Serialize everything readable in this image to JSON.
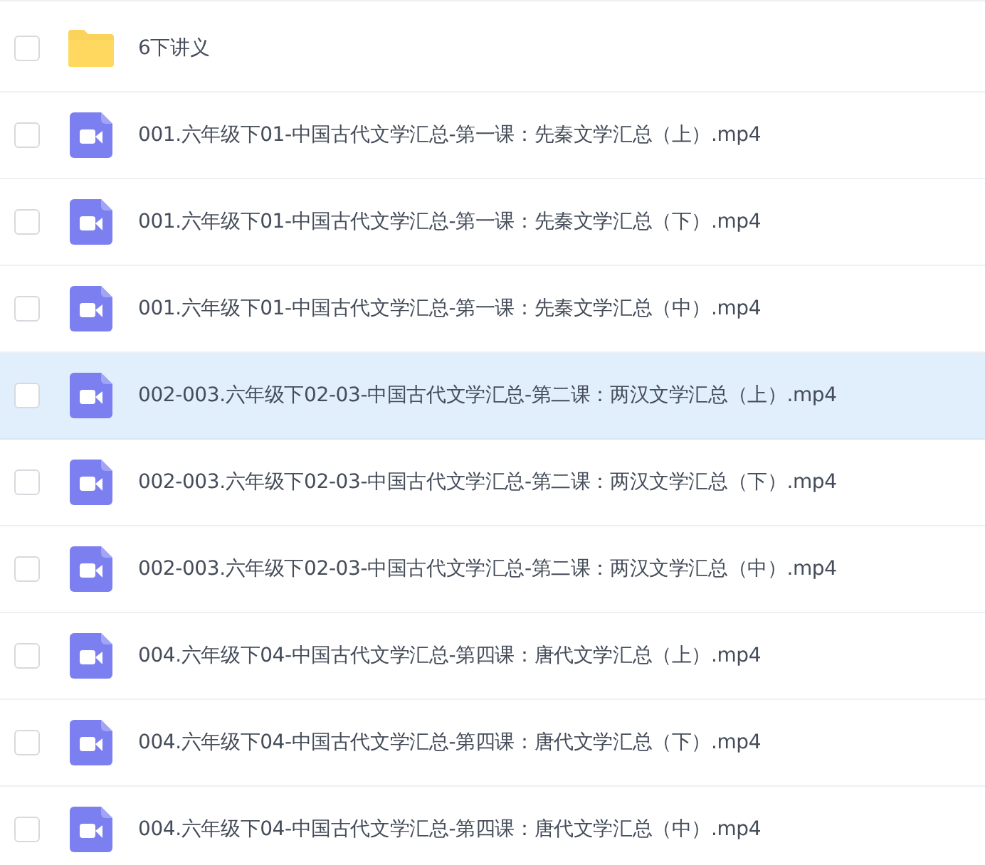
{
  "files": [
    {
      "kind": "folder",
      "name": "6下讲义",
      "checked": false,
      "hovered": false
    },
    {
      "kind": "video",
      "name": "001.六年级下01-中国古代文学汇总-第一课：先秦文学汇总（上）.mp4",
      "checked": false,
      "hovered": false
    },
    {
      "kind": "video",
      "name": "001.六年级下01-中国古代文学汇总-第一课：先秦文学汇总（下）.mp4",
      "checked": false,
      "hovered": false
    },
    {
      "kind": "video",
      "name": "001.六年级下01-中国古代文学汇总-第一课：先秦文学汇总（中）.mp4",
      "checked": false,
      "hovered": false
    },
    {
      "kind": "video",
      "name": "002-003.六年级下02-03-中国古代文学汇总-第二课：两汉文学汇总（上）.mp4",
      "checked": false,
      "hovered": true
    },
    {
      "kind": "video",
      "name": "002-003.六年级下02-03-中国古代文学汇总-第二课：两汉文学汇总（下）.mp4",
      "checked": false,
      "hovered": false
    },
    {
      "kind": "video",
      "name": "002-003.六年级下02-03-中国古代文学汇总-第二课：两汉文学汇总（中）.mp4",
      "checked": false,
      "hovered": false
    },
    {
      "kind": "video",
      "name": "004.六年级下04-中国古代文学汇总-第四课：唐代文学汇总（上）.mp4",
      "checked": false,
      "hovered": false
    },
    {
      "kind": "video",
      "name": "004.六年级下04-中国古代文学汇总-第四课：唐代文学汇总（下）.mp4",
      "checked": false,
      "hovered": false
    },
    {
      "kind": "video",
      "name": "004.六年级下04-中国古代文学汇总-第四课：唐代文学汇总（中）.mp4",
      "checked": false,
      "hovered": false
    }
  ]
}
